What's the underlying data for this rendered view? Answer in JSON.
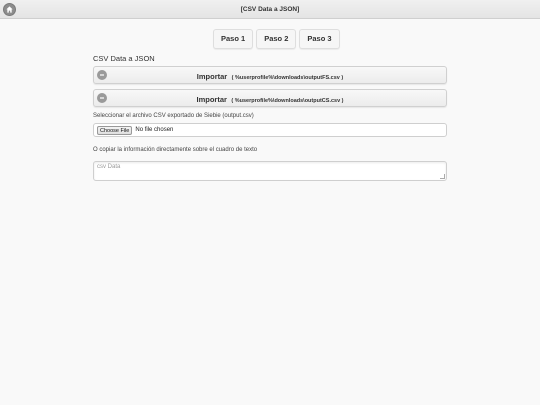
{
  "header": {
    "title": "[CSV Data a JSON]",
    "home_icon": "home-icon"
  },
  "tabs": [
    {
      "label": "Paso 1"
    },
    {
      "label": "Paso 2"
    },
    {
      "label": "Paso 3"
    }
  ],
  "main": {
    "section_title": "CSV Data a JSON",
    "import_buttons": [
      {
        "label": "Importar",
        "path": "( %userprofile%\\downloads\\outputFS.csv )",
        "icon": "minus-circle-icon"
      },
      {
        "label": "Importar",
        "path": "( %userprofile%\\downloads\\outputCS.csv )",
        "icon": "minus-circle-icon"
      }
    ],
    "file_label": "Seleccionar el archivo CSV exportado de Siebie (output.csv)",
    "file_button": "Choose File",
    "file_status": "No file chosen",
    "paste_label": "O copiar la información directamente sobre el cuadro de texto",
    "textarea_placeholder": "csv Data"
  },
  "colors": {
    "header_bg": "#e8e8e8",
    "page_bg": "#f9f9f9",
    "icon_gray": "#9a9a9a"
  }
}
